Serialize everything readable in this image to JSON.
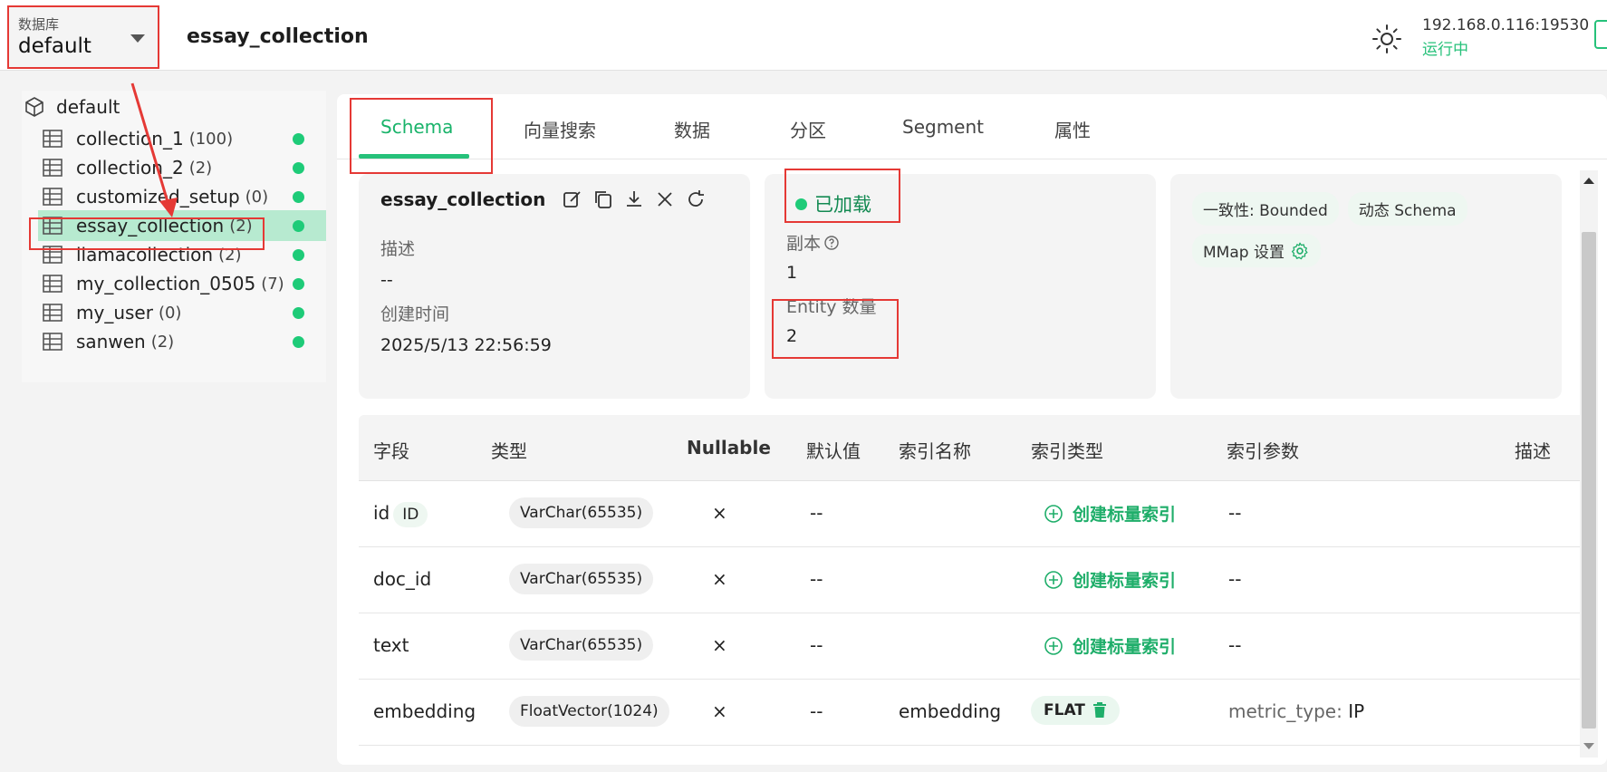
{
  "header": {
    "db_label": "数据库",
    "db_value": "default",
    "collection_title": "essay_collection",
    "address": "192.168.0.116:19530",
    "status": "运行中"
  },
  "sidebar": {
    "root": "default",
    "items": [
      {
        "name": "collection_1",
        "count": "(100)"
      },
      {
        "name": "collection_2",
        "count": "(2)"
      },
      {
        "name": "customized_setup",
        "count": "(0)"
      },
      {
        "name": "essay_collection",
        "count": "(2)"
      },
      {
        "name": "llamacollection",
        "count": "(2)"
      },
      {
        "name": "my_collection_0505",
        "count": "(7)"
      },
      {
        "name": "my_user",
        "count": "(0)"
      },
      {
        "name": "sanwen",
        "count": "(2)"
      }
    ]
  },
  "tabs": [
    "Schema",
    "向量搜索",
    "数据",
    "分区",
    "Segment",
    "属性"
  ],
  "info": {
    "name": "essay_collection",
    "desc_label": "描述",
    "desc_value": "--",
    "created_label": "创建时间",
    "created_value": "2025/5/13 22:56:59",
    "load_status": "已加载",
    "replica_label": "副本",
    "replica_value": "1",
    "entity_label": "Entity 数量",
    "entity_value": "2",
    "consistency": "一致性: Bounded",
    "dynamic_schema": "动态 Schema",
    "mmap": "MMap 设置"
  },
  "table": {
    "headers": [
      "字段",
      "类型",
      "Nullable",
      "默认值",
      "索引名称",
      "索引类型",
      "索引参数",
      "描述"
    ],
    "rows": [
      {
        "field": "id",
        "badge": "ID",
        "type": "VarChar(65535)",
        "nullable": "×",
        "default": "--",
        "index_name": "",
        "index_type": "创建标量索引",
        "index_params": "--"
      },
      {
        "field": "doc_id",
        "badge": "",
        "type": "VarChar(65535)",
        "nullable": "×",
        "default": "--",
        "index_name": "",
        "index_type": "创建标量索引",
        "index_params": "--"
      },
      {
        "field": "text",
        "badge": "",
        "type": "VarChar(65535)",
        "nullable": "×",
        "default": "--",
        "index_name": "",
        "index_type": "创建标量索引",
        "index_params": "--"
      },
      {
        "field": "embedding",
        "badge": "",
        "type": "FloatVector(1024)",
        "nullable": "×",
        "default": "--",
        "index_name": "embedding",
        "index_type": "FLAT",
        "index_params_key": "metric_type:",
        "index_params_val": "IP"
      }
    ]
  },
  "colors": {
    "accent": "#26c17a",
    "annotation": "#e53935",
    "active_row": "#b7ead0"
  }
}
